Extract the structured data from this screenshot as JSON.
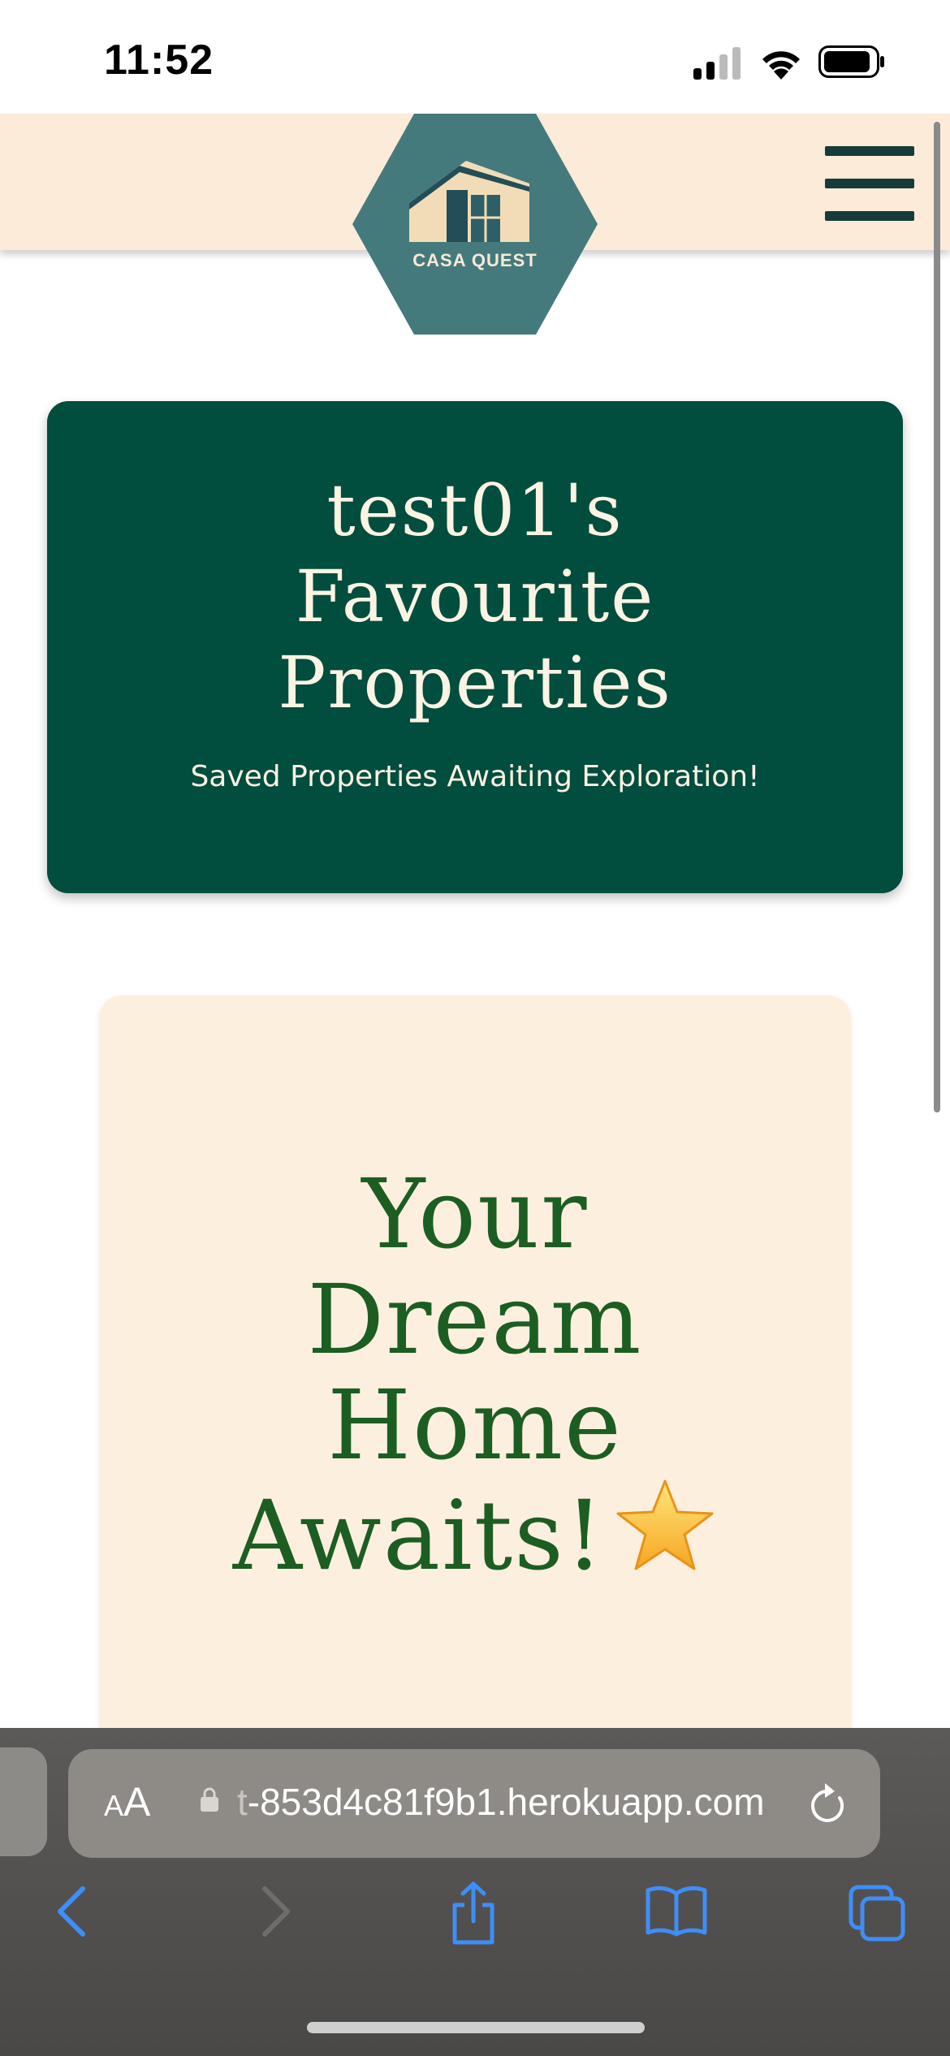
{
  "status_bar": {
    "time": "11:52",
    "signal_icon": "cellular-signal-icon",
    "wifi_icon": "wifi-icon",
    "battery_icon": "battery-icon"
  },
  "header": {
    "logo_text": "CASA QUEST",
    "logo_icon": "house-icon",
    "menu_icon": "hamburger-menu-icon",
    "background_color": "#fbebd8",
    "logo_color": "#457a7c"
  },
  "hero": {
    "title_lines": [
      "test01's",
      "Favourite",
      "Properties"
    ],
    "subtitle": "Saved Properties Awaiting Exploration!",
    "background_color": "#014d3e"
  },
  "empty_state": {
    "lines": [
      "Your",
      "Dream",
      "Home",
      "Awaits!"
    ],
    "emoji_icon": "star-icon",
    "text_color": "#1c5e22",
    "background_color": "#fdefde"
  },
  "browser": {
    "reader_small": "A",
    "reader_big": "A",
    "url_prefix": "t",
    "url": "-853d4c81f9b1.herokuapp.com",
    "lock_icon": "lock-icon",
    "reload_icon": "reload-icon",
    "toolbar": [
      "back-icon",
      "forward-icon",
      "share-icon",
      "bookmarks-icon",
      "tabs-icon"
    ],
    "accent_color": "#3e8ef7"
  }
}
